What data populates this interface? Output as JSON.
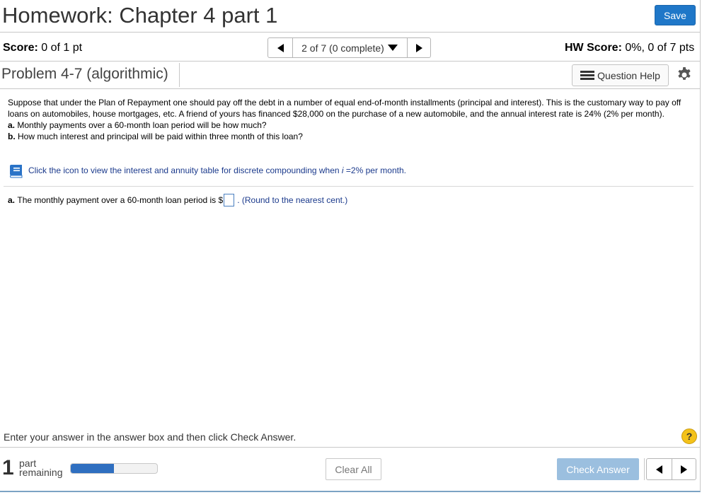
{
  "header": {
    "title": "Homework: Chapter 4 part 1",
    "save_label": "Save"
  },
  "score_bar": {
    "score_label": "Score:",
    "score_value": "0 of 1 pt",
    "nav_label": "2 of 7 (0 complete)",
    "hw_score_label": "HW Score:",
    "hw_score_value": "0%, 0 of 7 pts"
  },
  "problem": {
    "title": "Problem 4-7 (algorithmic)",
    "help_label": "Question Help",
    "statement": "Suppose that under the Plan of Repayment one should pay off the debt in a number of equal end-of-month installments (principal and interest). This is the customary way to pay off loans on automobiles, house mortgages, etc. A friend of yours has financed $28,000 on the purchase of a new automobile, and the annual interest rate is 24% (2% per month).",
    "part_a_label": "a.",
    "part_a_text": "Monthly payments over a 60-month loan period will be how much?",
    "part_b_label": "b.",
    "part_b_text": "How much interest and principal will be paid within three month of this loan?",
    "table_link_pre": "Click the icon to view the interest and annuity table for discrete compounding when ",
    "table_link_var": "i",
    "table_link_post": " =2% per month.",
    "answer_label": "a.",
    "answer_text": "The monthly payment over a 60-month loan period is $",
    "answer_value": "",
    "answer_note": ". (Round to the nearest cent.)"
  },
  "footer": {
    "instruction": "Enter your answer in the answer box and then click Check Answer.",
    "help_symbol": "?",
    "parts_remaining_count": "1",
    "parts_remaining_word1": "part",
    "parts_remaining_word2": "remaining",
    "progress_fraction": 0.5,
    "clear_label": "Clear All",
    "check_label": "Check Answer"
  },
  "colors": {
    "accent": "#1f77c8",
    "check_button": "#9bbfdf",
    "progress": "#2f6fc0",
    "link": "#1b3a8c",
    "help_icon": "#f4c21a"
  },
  "icons": [
    "previous-icon",
    "next-icon",
    "dropdown-icon",
    "list-icon",
    "gear-icon",
    "book-icon",
    "help-icon"
  ]
}
